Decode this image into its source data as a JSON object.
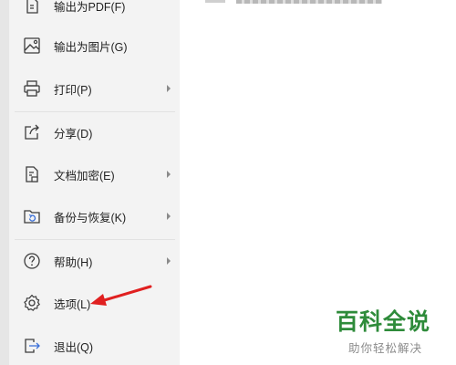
{
  "menu": {
    "items": [
      {
        "name": "export-pdf",
        "label": "输出为PDF(F)",
        "icon": "export-pdf-icon",
        "has_submenu": false
      },
      {
        "name": "export-image",
        "label": "输出为图片(G)",
        "icon": "export-image-icon",
        "has_submenu": false
      },
      {
        "name": "print",
        "label": "打印(P)",
        "icon": "printer-icon",
        "has_submenu": true
      },
      {
        "name": "share",
        "label": "分享(D)",
        "icon": "share-icon",
        "has_submenu": false
      },
      {
        "name": "encrypt",
        "label": "文档加密(E)",
        "icon": "document-lock-icon",
        "has_submenu": true
      },
      {
        "name": "backup",
        "label": "备份与恢复(K)",
        "icon": "backup-restore-icon",
        "has_submenu": true
      },
      {
        "name": "help",
        "label": "帮助(H)",
        "icon": "help-icon",
        "has_submenu": true
      },
      {
        "name": "options",
        "label": "选项(L)",
        "icon": "gear-icon",
        "has_submenu": false
      },
      {
        "name": "exit",
        "label": "退出(Q)",
        "icon": "exit-icon",
        "has_submenu": false
      }
    ]
  },
  "watermark": {
    "title": "百科全说",
    "subtitle": "助你轻松解决"
  },
  "colors": {
    "menu_background": "#f3f3f3",
    "page_strip": "#e6e6e6",
    "divider": "#e2e2e2",
    "icon_stroke": "#3c3c3c",
    "annotation_arrow": "#e02020",
    "watermark_title": "#2e8b3a",
    "watermark_subtitle": "#8c8c8c"
  }
}
